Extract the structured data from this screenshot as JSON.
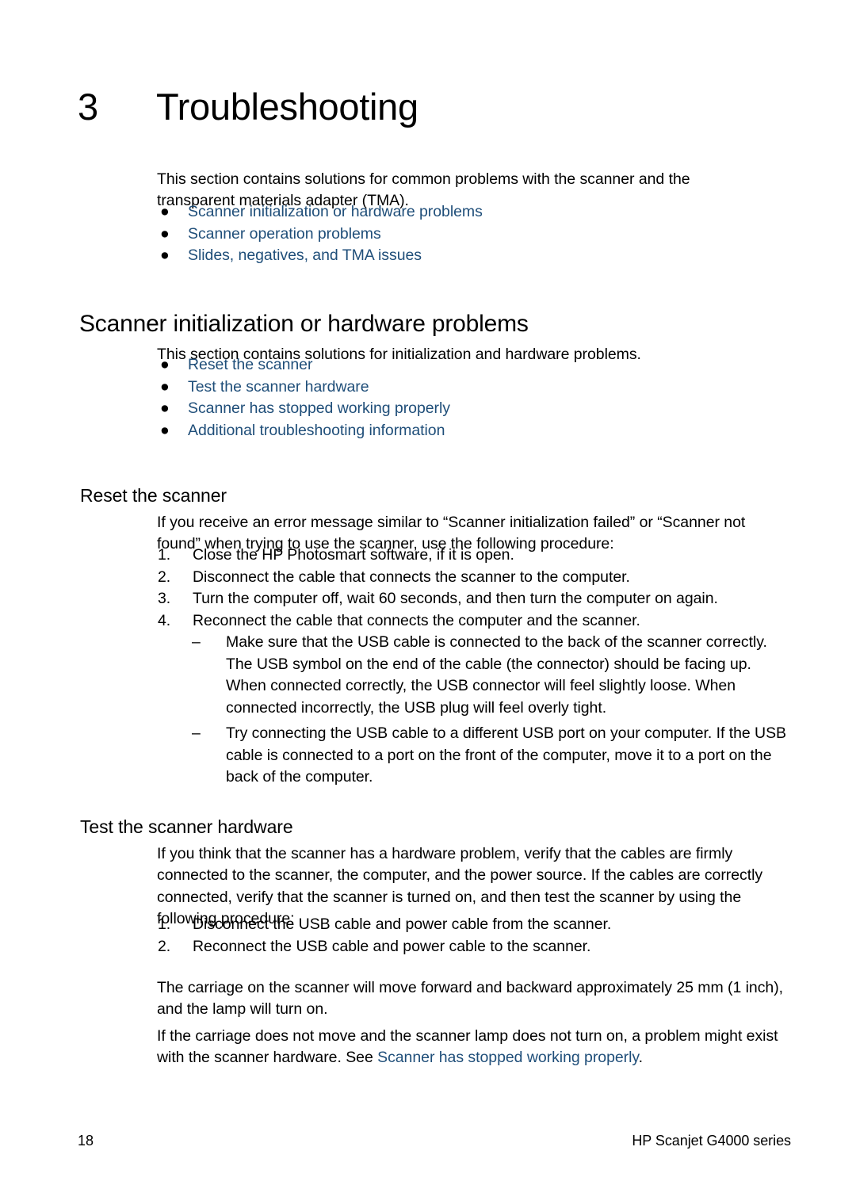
{
  "chapter": {
    "number": "3",
    "title": "Troubleshooting"
  },
  "intro": {
    "paragraph": "This section contains solutions for common problems with the scanner and the transparent materials adapter (TMA).",
    "links": [
      "Scanner initialization or hardware problems",
      "Scanner operation problems",
      "Slides, negatives, and TMA issues"
    ],
    "bullet_glyph": "●"
  },
  "section": {
    "heading": "Scanner initialization or hardware problems",
    "paragraph": "This section contains solutions for initialization and hardware problems.",
    "links": [
      "Reset the scanner",
      "Test the scanner hardware",
      "Scanner has stopped working properly",
      "Additional troubleshooting information"
    ]
  },
  "reset_scanner": {
    "heading": "Reset the scanner",
    "paragraph": "If you receive an error message similar to “Scanner initialization failed” or “Scanner not found” when trying to use the scanner, use the following procedure:",
    "steps": [
      {
        "marker": "1.",
        "text": "Close the HP Photosmart software, if it is open."
      },
      {
        "marker": "2.",
        "text": "Disconnect the cable that connects the scanner to the computer."
      },
      {
        "marker": "3.",
        "text": "Turn the computer off, wait 60 seconds, and then turn the computer on again."
      },
      {
        "marker": "4.",
        "text": "Reconnect the cable that connects the computer and the scanner."
      }
    ],
    "sub_items": [
      {
        "marker": "–",
        "text": "Make sure that the USB cable is connected to the back of the scanner correctly. The USB symbol on the end of the cable (the connector) should be facing up. When connected correctly, the USB connector will feel slightly loose. When connected incorrectly, the USB plug will feel overly tight."
      },
      {
        "marker": "–",
        "text": "Try connecting the USB cable to a different USB port on your computer. If the USB cable is connected to a port on the front of the computer, move it to a port on the back of the computer."
      }
    ]
  },
  "test_hardware": {
    "heading": "Test the scanner hardware",
    "paragraph": "If you think that the scanner has a hardware problem, verify that the cables are firmly connected to the scanner, the computer, and the power source. If the cables are correctly connected, verify that the scanner is turned on, and then test the scanner by using the following procedure:",
    "steps": [
      {
        "marker": "1.",
        "text": "Disconnect the USB cable and power cable from the scanner."
      },
      {
        "marker": "2.",
        "text": "Reconnect the USB cable and power cable to the scanner."
      }
    ],
    "carriage_paragraph": "The carriage on the scanner will move forward and backward approximately 25 mm (1 inch), and the lamp will turn on.",
    "closing_prefix": "If the carriage does not move and the scanner lamp does not turn on, a problem might exist with the scanner hardware. See ",
    "closing_link": "Scanner has stopped working properly",
    "closing_suffix": "."
  },
  "footer": {
    "page_number": "18",
    "product": "HP Scanjet G4000 series"
  },
  "colors": {
    "link": "#1f4e79",
    "text": "#000000",
    "background": "#ffffff"
  }
}
